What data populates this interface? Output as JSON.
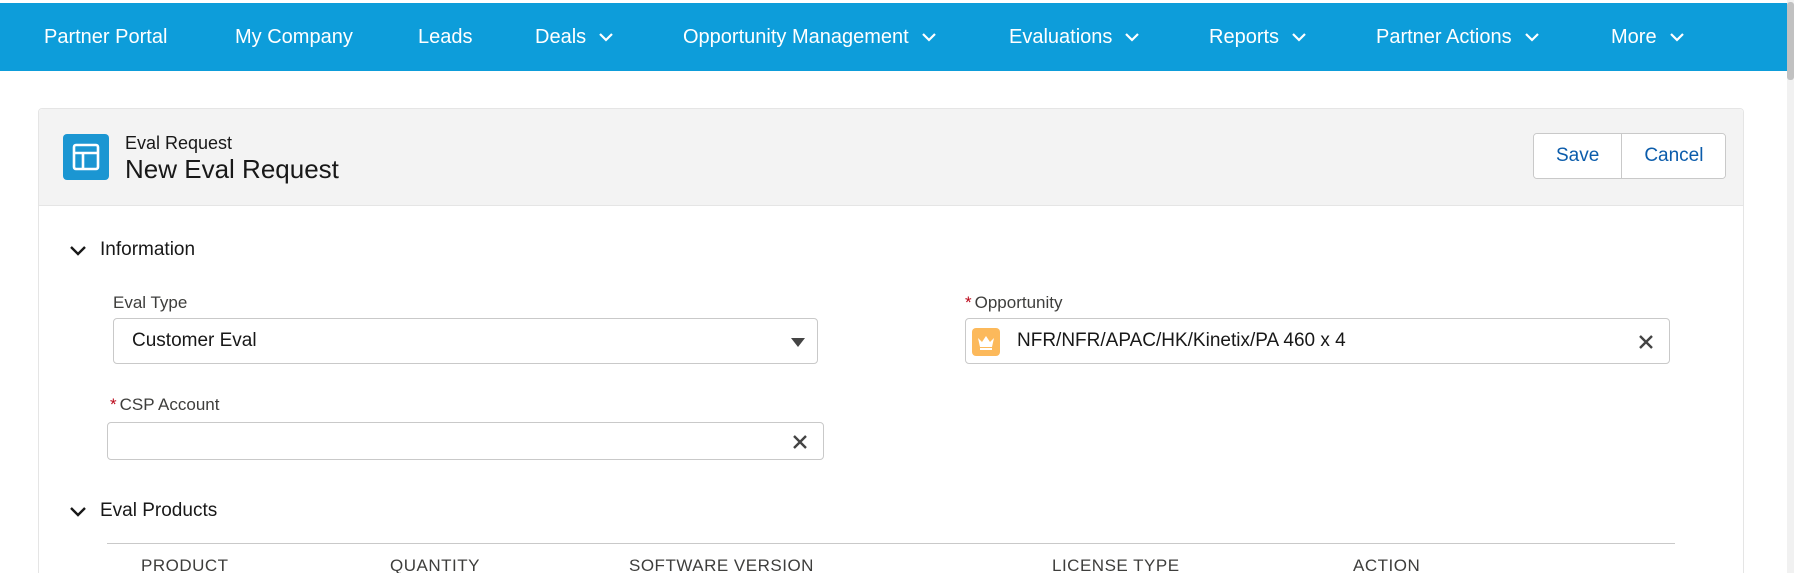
{
  "nav": {
    "items": [
      {
        "label": "Partner Portal",
        "has_dropdown": false
      },
      {
        "label": "My Company",
        "has_dropdown": false
      },
      {
        "label": "Leads",
        "has_dropdown": false
      },
      {
        "label": "Deals",
        "has_dropdown": true
      },
      {
        "label": "Opportunity Management",
        "has_dropdown": true
      },
      {
        "label": "Evaluations",
        "has_dropdown": true
      },
      {
        "label": "Reports",
        "has_dropdown": true
      },
      {
        "label": "Partner Actions",
        "has_dropdown": true
      },
      {
        "label": "More",
        "has_dropdown": true
      }
    ],
    "background": "#0d9dda"
  },
  "header": {
    "object_label": "Eval Request",
    "title": "New Eval Request",
    "save_label": "Save",
    "cancel_label": "Cancel",
    "icon": "record-layout-icon"
  },
  "information": {
    "section_label": "Information",
    "eval_type": {
      "label": "Eval Type",
      "value": "Customer Eval"
    },
    "opportunity": {
      "label": "Opportunity",
      "required_mark": "*",
      "value": "NFR/NFR/APAC/HK/Kinetix/PA 460 x 4",
      "icon": "opportunity-crown-icon"
    },
    "csp_account": {
      "label": "CSP Account",
      "required_mark": "*",
      "value": ""
    }
  },
  "eval_products": {
    "section_label": "Eval Products",
    "columns": [
      "PRODUCT",
      "QUANTITY",
      "SOFTWARE VERSION",
      "LICENSE TYPE",
      "ACTION"
    ]
  },
  "colors": {
    "accent": "#0d9dda",
    "link": "#0b5cab",
    "required": "#ba0517",
    "opportunity_icon": "#fcb95b"
  }
}
